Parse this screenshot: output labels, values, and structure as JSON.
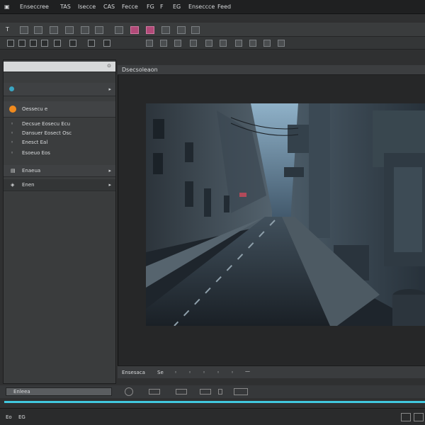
{
  "menubar": {
    "icon": "app-logo-icon",
    "items": [
      "Enseccree",
      "TAS",
      "Isecce",
      "CAS",
      "Fecce",
      "FG",
      "F",
      "EG",
      "Enseccce",
      "Feed"
    ]
  },
  "toolbar1": {
    "first_glyph": "T",
    "pink_color": "#b14a78"
  },
  "leftpanel": {
    "header_value": "",
    "section1": "",
    "group_label": "Oessecu e",
    "items": [
      "Decsue Eosecu Ecu",
      "Dansuer Eosect Osc",
      "Enesct Eal",
      "Esoeuo Eos"
    ],
    "row_a": "Enaeua",
    "row_b": "Enen",
    "accent_orange": "#f08a1e",
    "accent_cyan": "#3aa5c2"
  },
  "viewer": {
    "title": "Dsecsoleaon"
  },
  "viewerbar": {
    "label": "Ensesaca",
    "mark": "Se"
  },
  "bottom": {
    "input_text": "Enleea",
    "progress_color": "#41c8df"
  },
  "status": {
    "left_a": "Eo",
    "left_b": "EG"
  }
}
